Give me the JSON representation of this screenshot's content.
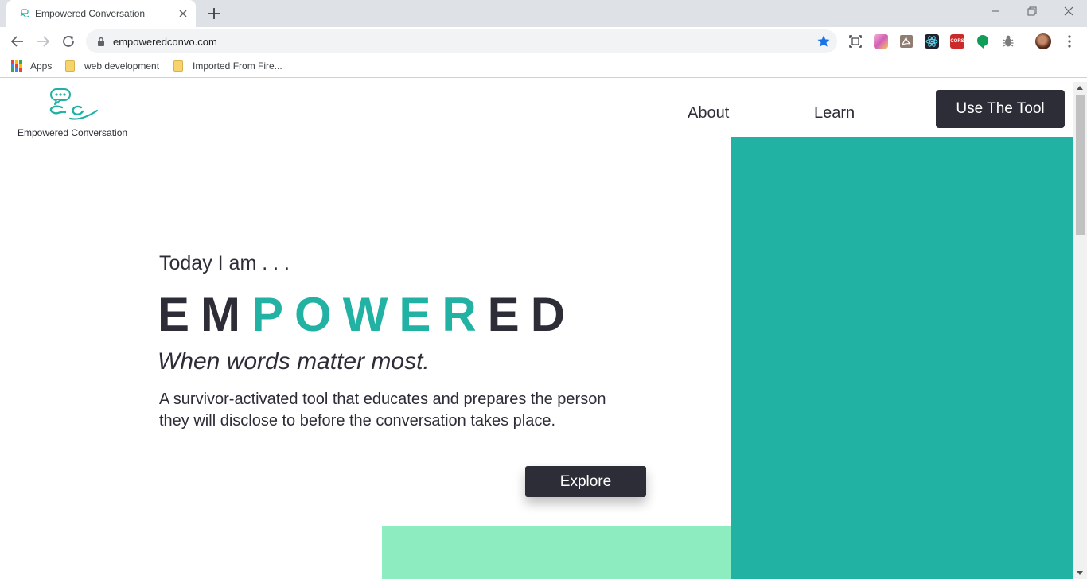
{
  "browser": {
    "tab_title": "Empowered Conversation",
    "url": "empoweredconvo.com",
    "bookmarks": [
      {
        "label": "Apps",
        "icon": "apps-grid-icon"
      },
      {
        "label": "web development",
        "icon": "folder-icon"
      },
      {
        "label": "Imported From Fire...",
        "icon": "folder-icon"
      }
    ],
    "extensions": [
      "screenshot-icon",
      "gradient-icon",
      "pdf-icon",
      "react-icon",
      "cors-icon",
      "hangouts-icon",
      "bug-icon"
    ],
    "extension_cors_label": "CORS"
  },
  "site": {
    "logo_text": "Empowered Conversation",
    "nav": {
      "about": "About",
      "learn": "Learn",
      "cta": "Use The Tool"
    },
    "hero": {
      "intro": "Today I am . . .",
      "headline_dark_start": "EM",
      "headline_accent": "POWER",
      "headline_dark_end": "ED",
      "tagline": "When words matter most.",
      "description": "A survivor-activated tool that educates and prepares the person they will disclose to before the conversation takes place.",
      "button": "Explore"
    }
  },
  "colors": {
    "teal": "#22b2a3",
    "mint": "#8decc0",
    "dark": "#2d2d38",
    "chrome_bg": "#dee1e6",
    "star_blue": "#1a73e8"
  }
}
